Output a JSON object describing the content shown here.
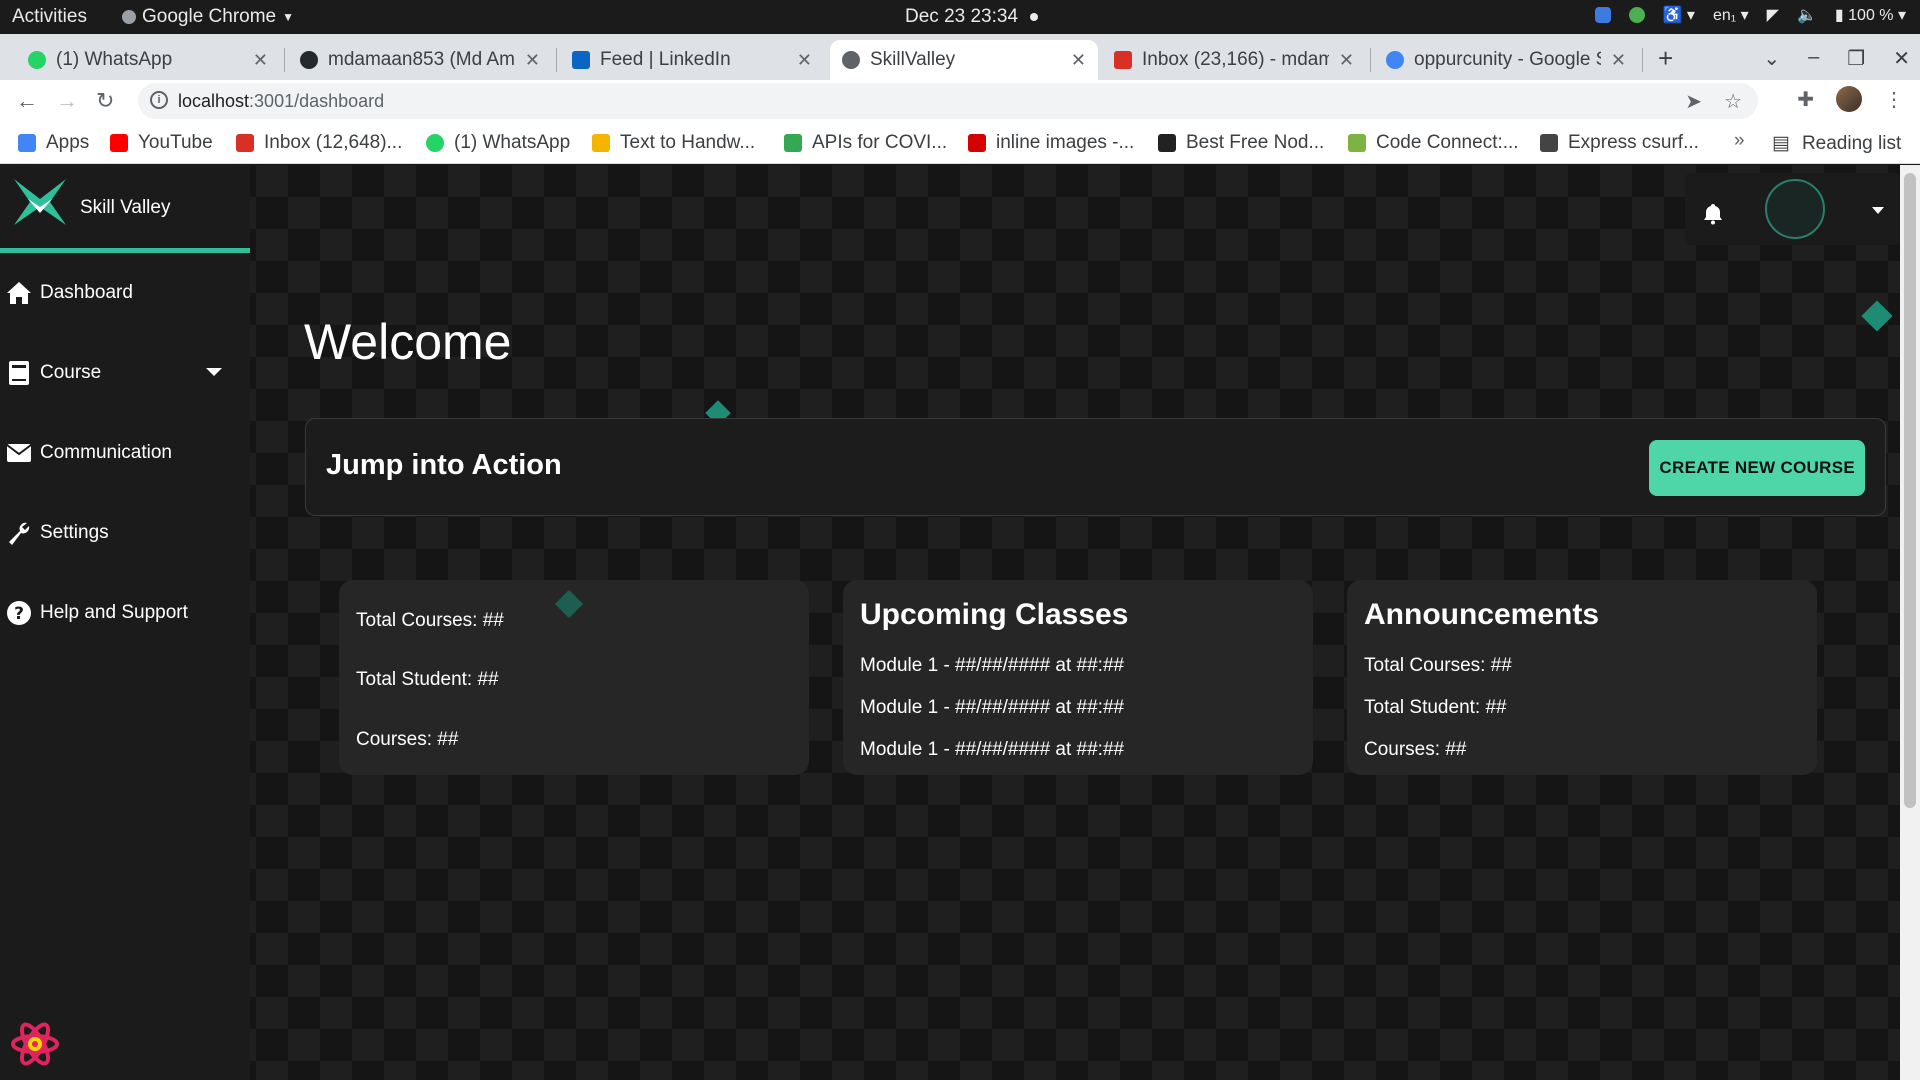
{
  "os_bar": {
    "activities": "Activities",
    "app_name": "Google Chrome",
    "clock": "Dec 23  23:34",
    "language": "en₁",
    "battery": "100 %"
  },
  "browser": {
    "tabs": [
      {
        "label": "(1) WhatsApp",
        "color": "#25d366"
      },
      {
        "label": "mdamaan853 (Md Ama",
        "color": "#24292e"
      },
      {
        "label": "Feed | LinkedIn",
        "color": "#0a66c2"
      },
      {
        "label": "SkillValley",
        "color": "#5f6368"
      },
      {
        "label": "Inbox (23,166) - mdam",
        "color": "#d93025"
      },
      {
        "label": "oppurcunity - Google S",
        "color": "#4285f4"
      }
    ],
    "url_host": "localhost",
    "url_path": ":3001/dashboard",
    "bookmarks": [
      {
        "label": "Apps",
        "color": "#4285f4"
      },
      {
        "label": "YouTube",
        "color": "#ff0000"
      },
      {
        "label": "Inbox (12,648)...",
        "color": "#d93025"
      },
      {
        "label": "(1) WhatsApp",
        "color": "#25d366"
      },
      {
        "label": "Text to Handw...",
        "color": "#f4b400"
      },
      {
        "label": "APIs for COVI...",
        "color": "#34a853"
      },
      {
        "label": "inline images -...",
        "color": "#d50000"
      },
      {
        "label": "Best Free Nod...",
        "color": "#222222"
      },
      {
        "label": "Code Connect:...",
        "color": "#7cb342"
      },
      {
        "label": "Express csurf...",
        "color": "#444444"
      }
    ],
    "bookmarks_more": "»",
    "reading_list": "Reading list"
  },
  "app": {
    "brand_name": "Skill Valley",
    "accent": "#2fbf9a",
    "nav": [
      {
        "label": "Dashboard",
        "icon": "home-icon"
      },
      {
        "label": "Course",
        "icon": "book-icon"
      },
      {
        "label": "Communication",
        "icon": "envelope-icon"
      },
      {
        "label": "Settings",
        "icon": "wrench-icon"
      },
      {
        "label": "Help and Support",
        "icon": "help-circle-icon"
      }
    ],
    "welcome": "Welcome",
    "action": {
      "title": "Jump into Action",
      "button": "CREATE NEW COURSE",
      "button_color": "#4fd6a8"
    },
    "stats": [
      "Total Courses: ##",
      "Total Student: ##",
      "Courses: ##"
    ],
    "upcoming": {
      "title": "Upcoming Classes",
      "items": [
        "Module 1 - ##/##/#### at ##:##",
        "Module 1 - ##/##/#### at ##:##",
        "Module 1 - ##/##/#### at ##:##"
      ]
    },
    "announcements": {
      "title": "Announcements",
      "items": [
        "Total Courses: ##",
        "Total Student: ##",
        "Courses: ##"
      ]
    }
  }
}
